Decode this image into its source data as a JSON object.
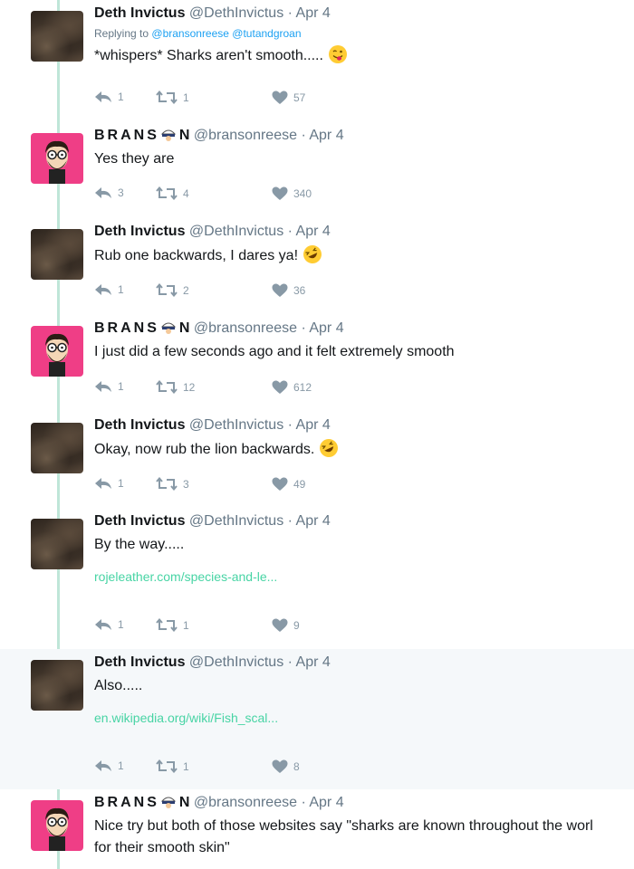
{
  "tweets": [
    {
      "name": "Deth Invictus",
      "handle": "@DethInvictus",
      "date": "Apr 4",
      "reply_label": "Replying to",
      "reply_mentions": "@bransonreese @tutandgroan",
      "text": "*whispers*  Sharks aren't smooth.....",
      "emoji": "tongue-wink-emoji",
      "replies": "1",
      "retweets": "1",
      "likes": "57"
    },
    {
      "name_pre": "BRANS",
      "name_post": "N",
      "handle": "@bransonreese",
      "date": "Apr 4",
      "text": "Yes they are",
      "replies": "3",
      "retweets": "4",
      "likes": "340"
    },
    {
      "name": "Deth Invictus",
      "handle": "@DethInvictus",
      "date": "Apr 4",
      "text": "Rub one backwards, I dares ya!",
      "emoji": "rofl-emoji",
      "replies": "1",
      "retweets": "2",
      "likes": "36"
    },
    {
      "name_pre": "BRANS",
      "name_post": "N",
      "handle": "@bransonreese",
      "date": "Apr 4",
      "text": "I just did a few seconds ago and it felt extremely smooth",
      "replies": "1",
      "retweets": "12",
      "likes": "612"
    },
    {
      "name": "Deth Invictus",
      "handle": "@DethInvictus",
      "date": "Apr 4",
      "text": "Okay, now rub the lion backwards.",
      "emoji": "rofl-emoji",
      "replies": "1",
      "retweets": "3",
      "likes": "49"
    },
    {
      "name": "Deth Invictus",
      "handle": "@DethInvictus",
      "date": "Apr 4",
      "text": "By the way.....",
      "link": "rojeleather.com/species-and-le...",
      "replies": "1",
      "retweets": "1",
      "likes": "9"
    },
    {
      "name": "Deth Invictus",
      "handle": "@DethInvictus",
      "date": "Apr 4",
      "text": "Also.....",
      "link": "en.wikipedia.org/wiki/Fish_scal...",
      "replies": "1",
      "retweets": "1",
      "likes": "8",
      "highlighted": true
    },
    {
      "name_pre": "BRANS",
      "name_post": "N",
      "handle": "@bransonreese",
      "date": "Apr 4",
      "text": "Nice try but both of those websites say \"sharks are known throughout the worl",
      "text2": "for their smooth skin\""
    }
  ],
  "separator": "·",
  "colors": {
    "thread_line": "#bfe6d8",
    "link": "#47d4a4",
    "mention": "#1da1f2",
    "highlight_bg": "#f5f8fa",
    "brans_avatar_bg": "#ef3e86"
  }
}
